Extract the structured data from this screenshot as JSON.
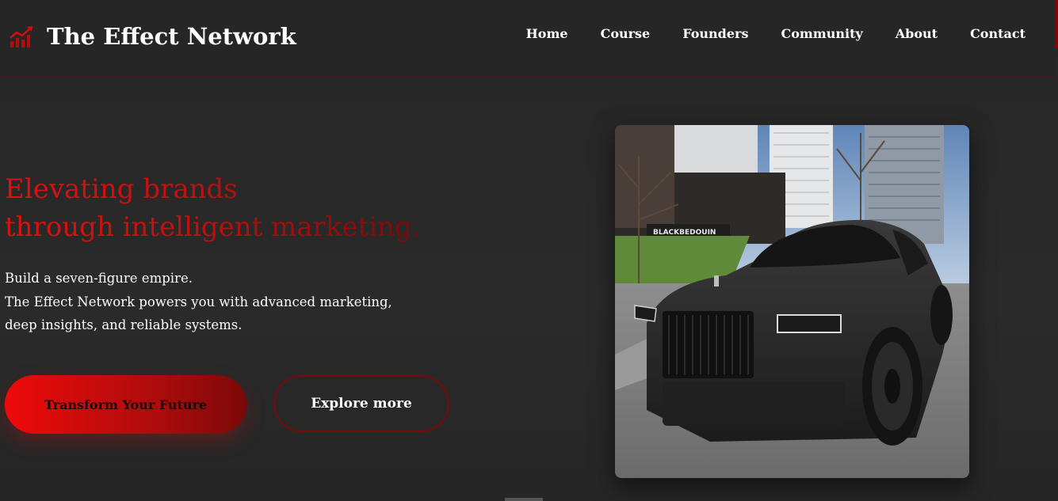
{
  "brand": {
    "title": "The Effect Network",
    "icon": "chart-line-up-icon",
    "accent_color": "#d10f0f"
  },
  "nav": {
    "items": [
      {
        "label": "Home"
      },
      {
        "label": "Course"
      },
      {
        "label": "Founders"
      },
      {
        "label": "Community"
      },
      {
        "label": "About"
      },
      {
        "label": "Contact"
      }
    ]
  },
  "hero": {
    "title_line1": "Elevating brands",
    "title_line2": "through intelligent marketing.",
    "text_line1": "Build a seven-figure empire.",
    "text_line2": "The Effect Network powers you with advanced marketing,",
    "text_line3": "deep insights, and reliable systems.",
    "primary_button": "Transform Your Future",
    "secondary_button": "Explore more",
    "image_sign_text": "BLACKBEDOUIN",
    "colors": {
      "title_gradient_start": "#e01010",
      "title_gradient_end": "#7a0a0a",
      "button_gradient_start": "#ee0a0a",
      "button_gradient_end": "#7d0808",
      "background": "#282828"
    }
  }
}
